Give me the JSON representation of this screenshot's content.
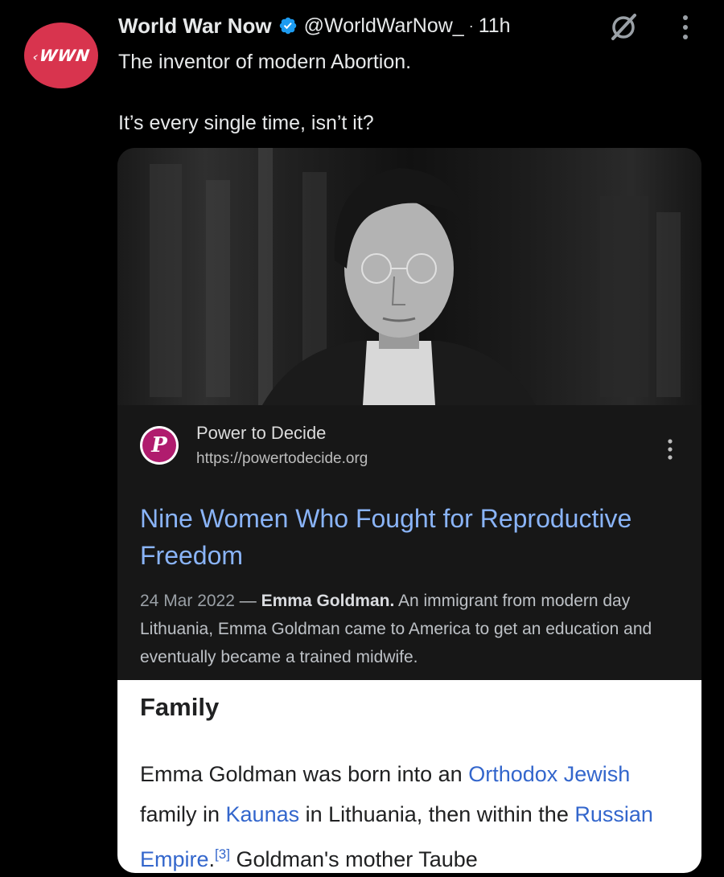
{
  "tweet": {
    "avatar_text": "WWN",
    "display_name": "World War Now",
    "handle": "@WorldWarNow_",
    "separator": "·",
    "time": "11h",
    "text_line1": "The inventor of modern Abortion.",
    "text_line2": "It’s every single time, isn’t it?"
  },
  "card": {
    "photo_description": "Black and white portrait photograph of a woman wearing round glasses",
    "site_logo_letter": "P",
    "site_name": "Power to Decide",
    "site_url": "https://powertodecide.org",
    "result_title": "Nine Women Who Fought for Reproductive Freedom",
    "snippet_date": "24 Mar 2022",
    "snippet_dash": " — ",
    "snippet_bold": "Emma Goldman.",
    "snippet_rest": " An immigrant from modern day Lithuania, Emma Goldman came to America to get an education and eventually became a trained midwife.",
    "wiki_heading": "Family",
    "wiki": {
      "t1": "Emma Goldman was born into an ",
      "link1": "Orthodox Jewish",
      "t2": " family in ",
      "link2": "Kaunas",
      "t3": " in Lithuania, then within the ",
      "link3": "Russian Empire",
      "t4": ".",
      "ref": "[3]",
      "t5": " Goldman's mother Taube"
    }
  },
  "colors": {
    "background": "#000000",
    "avatar_bg": "#d8344e",
    "verified": "#1d9bf0",
    "link_blue": "#8ab4f8",
    "wiki_link": "#3366cc"
  },
  "icons": [
    "verified-badge-icon",
    "grok-icon",
    "more-options-icon",
    "site-logo-icon",
    "result-more-icon"
  ]
}
